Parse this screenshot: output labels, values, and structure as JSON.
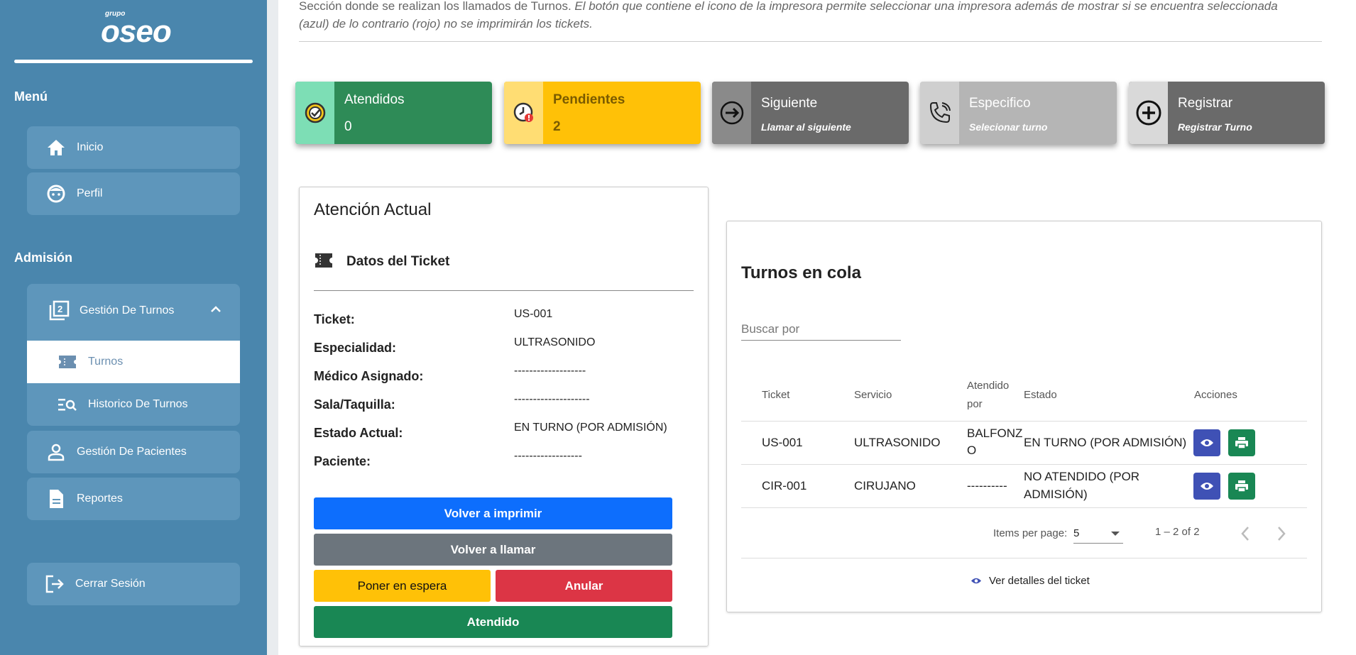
{
  "logo": {
    "small": "grupo",
    "big": "oseo"
  },
  "sidebar": {
    "menu_title": "Menú",
    "inicio": "Inicio",
    "perfil": "Perfil",
    "admision_title": "Admisión",
    "gestion_turnos": "Gestión De Turnos",
    "turnos": "Turnos",
    "historico": "Historico De Turnos",
    "gestion_pacientes": "Gestión De Pacientes",
    "reportes": "Reportes",
    "cerrar_sesion": "Cerrar Sesión"
  },
  "description": {
    "line1_normal": "Sección donde se realizan los llamados de Turnos.",
    "line1_italic": " El botón que contiene el icono de la impresora permite seleccionar una impresora además de mostrar si se encuentra seleccionada",
    "line2_italic": "(azul) de lo contrario (rojo) no se imprimirán los tickets."
  },
  "cards": {
    "atendidos": {
      "title": "Atendidos",
      "value": "0"
    },
    "pendientes": {
      "title": "Pendientes",
      "value": "2"
    },
    "siguiente": {
      "title": "Siguiente",
      "sub": "Llamar al siguiente"
    },
    "especifico": {
      "title": "Especifico",
      "sub": "Selecionar turno"
    },
    "registrar": {
      "title": "Registrar",
      "sub": "Registrar Turno"
    }
  },
  "atencion": {
    "title": "Atención Actual",
    "datos_title": "Datos del Ticket",
    "rows": [
      {
        "label": "Ticket:",
        "value": "US-001"
      },
      {
        "label": "Especialidad:",
        "value": "ULTRASONIDO"
      },
      {
        "label": "Médico Asignado:",
        "value": "-------------------"
      },
      {
        "label": "Sala/Taquilla:",
        "value": "--------------------"
      },
      {
        "label": "Estado Actual:",
        "value": "EN TURNO (POR ADMISIÓN)"
      },
      {
        "label": "Paciente:",
        "value": "------------------"
      }
    ],
    "buttons": {
      "reimprimir": "Volver a imprimir",
      "rellamar": "Volver a llamar",
      "espera": "Poner en espera",
      "anular": "Anular",
      "atendido": "Atendido"
    },
    "colors": {
      "blue": "#0d6efd",
      "gray": "#6c757d",
      "yellow": "#ffc107",
      "red": "#dc3545",
      "green": "#198754"
    }
  },
  "cola": {
    "title": "Turnos en cola",
    "search_placeholder": "Buscar por",
    "headers": {
      "ticket": "Ticket",
      "servicio": "Servicio",
      "atendido_1": "Atendido",
      "atendido_2": "por",
      "estado": "Estado",
      "acciones": "Acciones"
    },
    "rows": [
      {
        "ticket": "US-001",
        "servicio": "ULTRASONIDO",
        "atendido_1": "BALFONZ",
        "atendido_2": "O",
        "estado_1": "EN TURNO (POR ADMISIÓN)",
        "estado_2": ""
      },
      {
        "ticket": "CIR-001",
        "servicio": "CIRUJANO",
        "atendido_1": "----------",
        "atendido_2": "",
        "estado_1": "NO ATENDIDO (POR",
        "estado_2": "ADMISIÓN)"
      }
    ],
    "items_per_page_label": "Items per page:",
    "items_per_page": "5",
    "range": "1 – 2 of 2",
    "footer": "Ver detalles del ticket"
  }
}
